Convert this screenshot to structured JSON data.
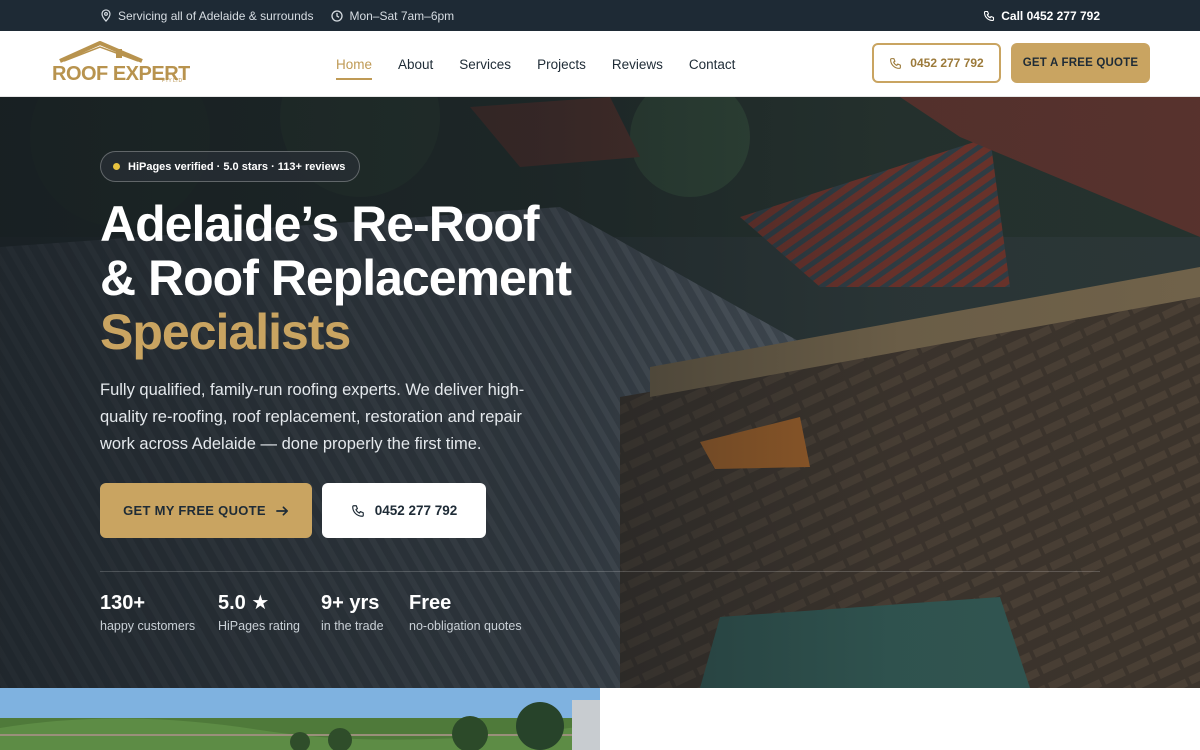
{
  "topbar": {
    "service_area": "Servicing all of Adelaide & surrounds",
    "hours": "Mon–Sat 7am–6pm",
    "call": "Call 0452 277 792"
  },
  "logo": {
    "text_main": "ROOF EXPERT",
    "text_small": "PTY LTD"
  },
  "nav": {
    "items": [
      {
        "label": "Home",
        "active": true
      },
      {
        "label": "About"
      },
      {
        "label": "Services"
      },
      {
        "label": "Projects"
      },
      {
        "label": "Reviews"
      },
      {
        "label": "Contact"
      }
    ]
  },
  "header": {
    "phone": "0452 277 792",
    "quote_button": "GET A FREE QUOTE"
  },
  "hero": {
    "badge": "HiPages verified · 5.0 stars · 113+ reviews",
    "headline_line1": "Adelaide’s Re-Roof",
    "headline_line2": "& Roof Replacement",
    "headline_accent": "Specialists",
    "lead": "Fully qualified, family-run roofing experts. We deliver high-quality re-roofing, roof replacement, restoration and repair work across Adelaide — done properly the first time.",
    "primary_button": "GET MY FREE QUOTE",
    "secondary_button": "0452 277 792",
    "stats": [
      {
        "value": "130+",
        "label": "happy customers"
      },
      {
        "value": "5.0 ★",
        "label": "HiPages rating"
      },
      {
        "value": "9+ yrs",
        "label": "in the trade"
      },
      {
        "value": "Free",
        "label": "no-obligation quotes"
      }
    ]
  },
  "colors": {
    "brand_gold": "#c9a461",
    "dark_navy": "#1e2a35",
    "badge_dot": "#e8c33f"
  }
}
